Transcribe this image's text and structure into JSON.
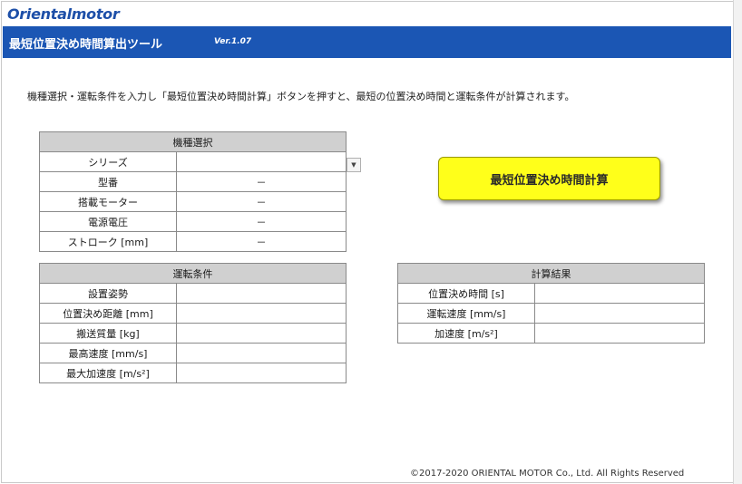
{
  "logo": "Orientalmotor",
  "app": {
    "title": "最短位置決め時間算出ツール",
    "version": "Ver.1.07"
  },
  "instruction": "機種選択・運転条件を入力し「最短位置決め時間計算」ボタンを押すと、最短の位置決め時間と運転条件が計算されます。",
  "model_selection": {
    "header": "機種選択",
    "rows": [
      {
        "label": "シリーズ",
        "value": ""
      },
      {
        "label": "型番",
        "value": "－"
      },
      {
        "label": "搭載モーター",
        "value": "－"
      },
      {
        "label": "電源電圧",
        "value": "－"
      },
      {
        "label": "ストローク [mm]",
        "value": "－"
      }
    ]
  },
  "operating_conditions": {
    "header": "運転条件",
    "rows": [
      {
        "label": "設置姿勢",
        "value": ""
      },
      {
        "label": "位置決め距離 [mm]",
        "value": ""
      },
      {
        "label": "搬送質量 [kg]",
        "value": ""
      },
      {
        "label": "最高速度 [mm/s]",
        "value": ""
      },
      {
        "label": "最大加速度 [m/s²]",
        "value": ""
      }
    ]
  },
  "calc_button": {
    "label": "最短位置決め時間計算"
  },
  "results": {
    "header": "計算結果",
    "rows": [
      {
        "label": "位置決め時間 [s]",
        "value": ""
      },
      {
        "label": "運転速度 [mm/s]",
        "value": ""
      },
      {
        "label": "加速度 [m/s²]",
        "value": ""
      }
    ]
  },
  "copyright": "©2017-2020 ORIENTAL MOTOR Co., Ltd. All Rights Reserved",
  "colors": {
    "title_bar": "#1b56b4",
    "button": "#ffff1a",
    "header_cell": "#d0d0d0",
    "logo": "#1d4fa8"
  }
}
